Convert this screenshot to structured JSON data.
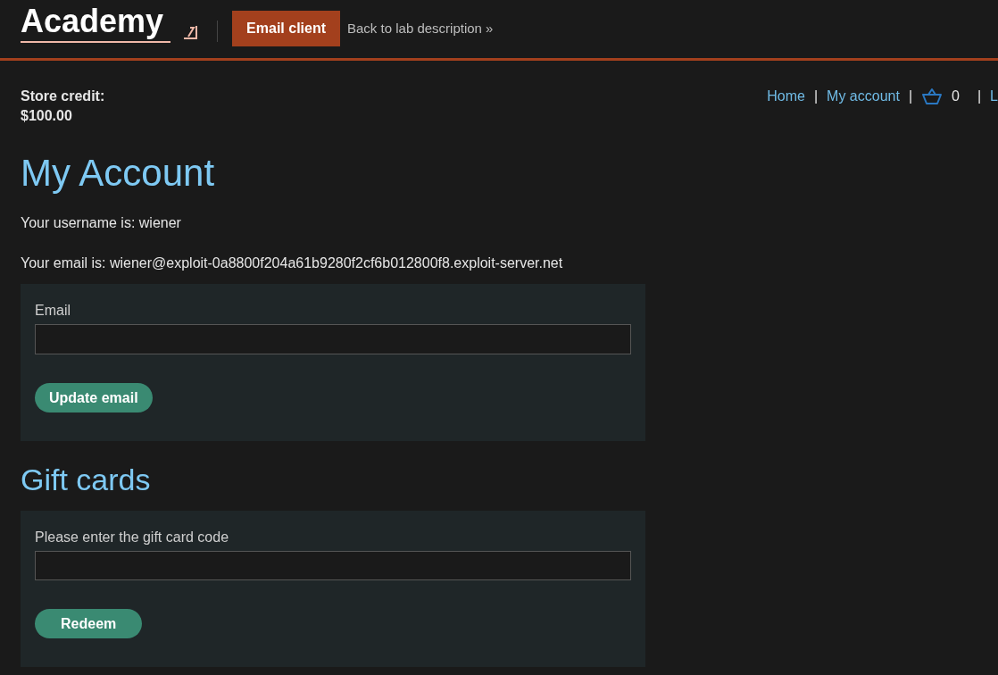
{
  "header": {
    "logo": "Academy",
    "email_client_button": "Email client",
    "back_link": "Back to lab description »"
  },
  "store_credit": {
    "label": "Store credit:",
    "amount": "$100.00"
  },
  "nav": [
    {
      "kind": "link",
      "label": "Home"
    },
    {
      "kind": "link",
      "label": "My account",
      "separator": "|"
    },
    {
      "kind": "cart",
      "label": "0",
      "separator": "|"
    },
    {
      "kind": "link",
      "label": "L",
      "separator": "|"
    }
  ],
  "title": "My Account",
  "username_line": "Your username is: wiener",
  "email_line": "Your email is: wiener@exploit-0a8800f204a61b9280f2cf6b012800f8.exploit-server.net",
  "email_form": {
    "label": "Email",
    "button": "Update email"
  },
  "gift_title": "Gift cards",
  "gift_form": {
    "label": "Please enter the gift card code",
    "button": "Redeem"
  }
}
